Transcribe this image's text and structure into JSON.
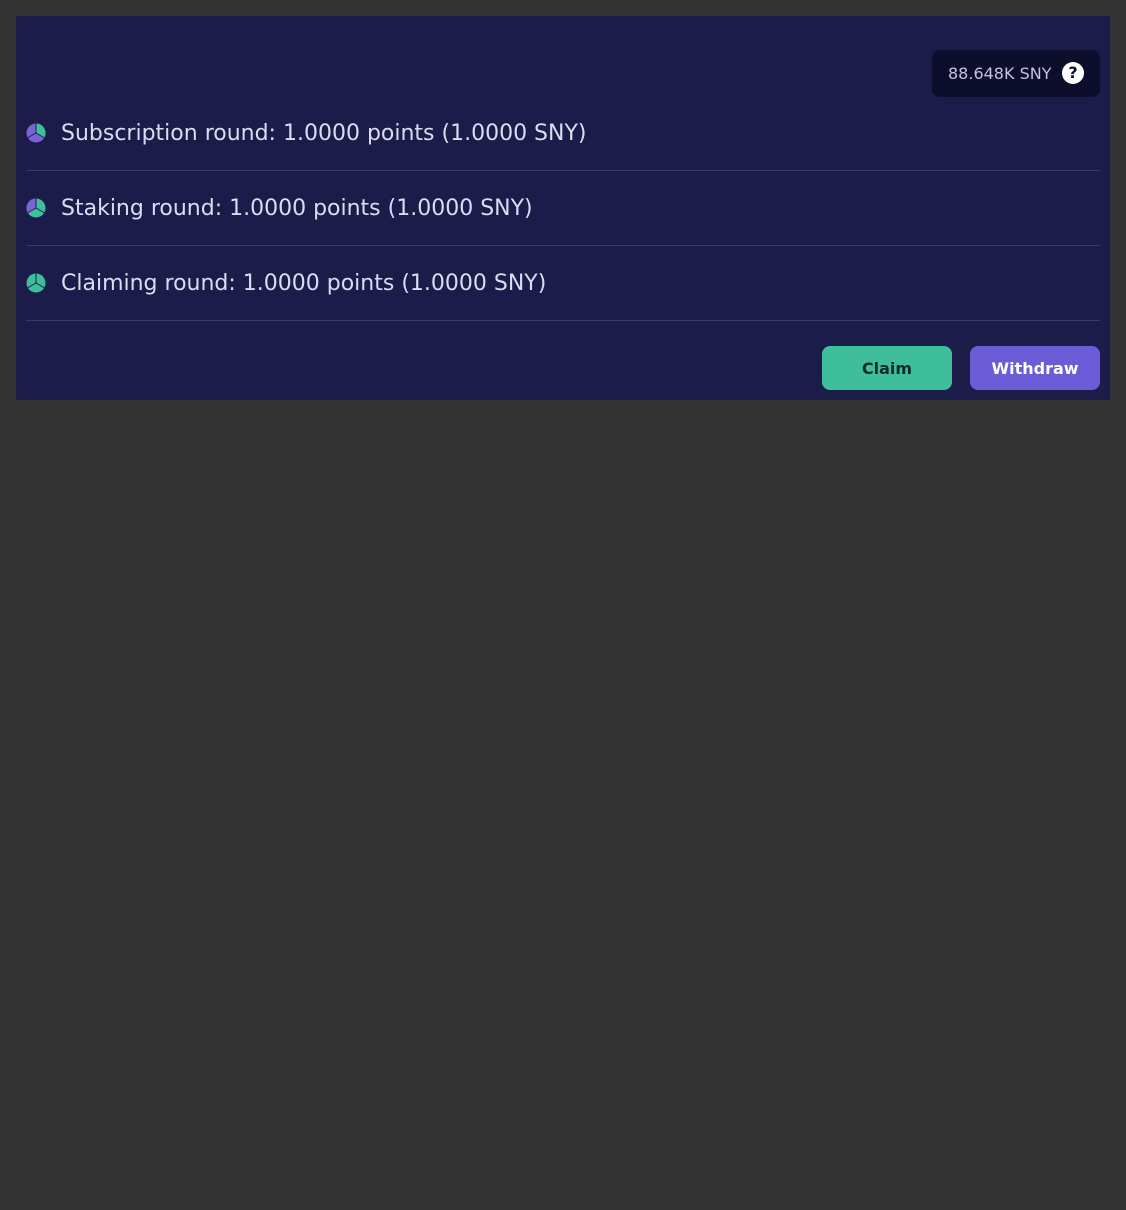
{
  "balance": {
    "value": "88.648K SNY",
    "help_symbol": "?"
  },
  "rounds": [
    {
      "label": "Subscription round: 1.0000 points (1.0000 SNY)",
      "icon": "pie-chart-icon"
    },
    {
      "label": "Staking round: 1.0000 points (1.0000 SNY)",
      "icon": "pie-chart-icon"
    },
    {
      "label": "Claiming round: 1.0000 points (1.0000 SNY)",
      "icon": "pie-chart-icon"
    }
  ],
  "actions": {
    "claim_label": "Claim",
    "withdraw_label": "Withdraw"
  },
  "colors": {
    "page_background": "#333333",
    "panel_background": "#1c1c4b",
    "claim_button": "#3fbe9c",
    "withdraw_button": "#6b5bd6",
    "pie_purple": "#7b63d6",
    "pie_teal": "#3fbe9c"
  }
}
